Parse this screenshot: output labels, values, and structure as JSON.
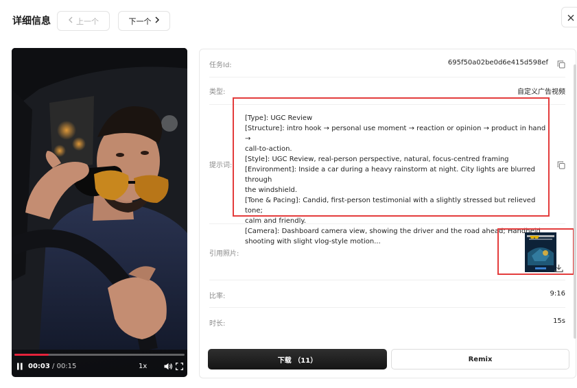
{
  "header": {
    "title": "详细信息",
    "prev_label": "上一个",
    "next_label": "下一个"
  },
  "video": {
    "current_time": "00:03",
    "separator": " / ",
    "duration": "00:15",
    "speed": "1x",
    "progress": 0.2
  },
  "details": {
    "task_id_label": "任务Id:",
    "task_id_value": "695f50a02be0d6e415d598ef",
    "type_label": "类型:",
    "type_value": "自定义广告视频",
    "prompt_label": "提示词:",
    "prompt_lines": [
      "[Type]: UGC Review",
      "[Structure]: intro hook → personal use moment → reaction or opinion → product in hand →",
      "call-to-action.",
      "[Style]: UGC Review, real-person perspective, natural, focus-centred framing",
      "[Environment]: Inside a car during a heavy rainstorm at night. City lights are blurred through",
      "the windshield.",
      "[Tone & Pacing]: Candid, first-person testimonial with a slightly stressed but relieved tone;",
      "calm and friendly.",
      "[Camera]: Dashboard camera view, showing the driver and the road ahead; Handheld",
      "shooting with slight vlog-style motion..."
    ],
    "ref_photo_label": "引用照片:",
    "ratio_label": "比率:",
    "ratio_value": "9:16",
    "duration_label": "时长:",
    "duration_value": "15s"
  },
  "actions": {
    "download_label": "下载 （11）",
    "remix_label": "Remix"
  }
}
